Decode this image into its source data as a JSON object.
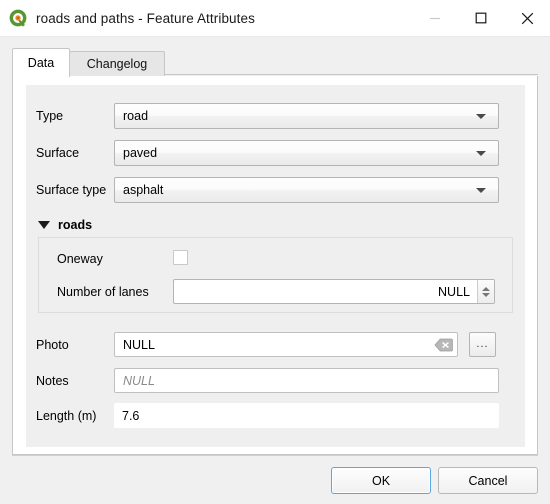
{
  "window": {
    "title": "roads and paths - Feature Attributes",
    "app_icon": "qgis-logo-icon",
    "controls": {
      "minimize": "—",
      "maximize": "□",
      "close": "✕"
    }
  },
  "tabs": [
    {
      "label": "Data",
      "selected": true
    },
    {
      "label": "Changelog",
      "selected": false
    }
  ],
  "form": {
    "type": {
      "label": "Type",
      "value": "road",
      "widget": "combobox"
    },
    "surface": {
      "label": "Surface",
      "value": "paved",
      "widget": "combobox"
    },
    "surface_type": {
      "label": "Surface type",
      "value": "asphalt",
      "widget": "combobox"
    },
    "group_roads": {
      "title": "roads",
      "expanded": true,
      "oneway": {
        "label": "Oneway",
        "checked": false,
        "widget": "checkbox"
      },
      "number_of_lanes": {
        "label": "Number of lanes",
        "value": "NULL",
        "widget": "spinbox"
      }
    },
    "photo": {
      "label": "Photo",
      "value": "NULL",
      "widget": "lineedit",
      "clear_icon": "clear-x-icon",
      "browse_label": "..."
    },
    "notes": {
      "label": "Notes",
      "value": "",
      "placeholder": "NULL",
      "widget": "lineedit"
    },
    "length": {
      "label": "Length (m)",
      "value": "7.6",
      "widget": "readonly-field"
    }
  },
  "buttons": {
    "ok": "OK",
    "cancel": "Cancel"
  },
  "colors": {
    "accent": "#5aa7e0",
    "panel": "#efefef",
    "window": "#f0f0f0",
    "logo_green": "#589632",
    "logo_orange": "#e98a2b"
  }
}
